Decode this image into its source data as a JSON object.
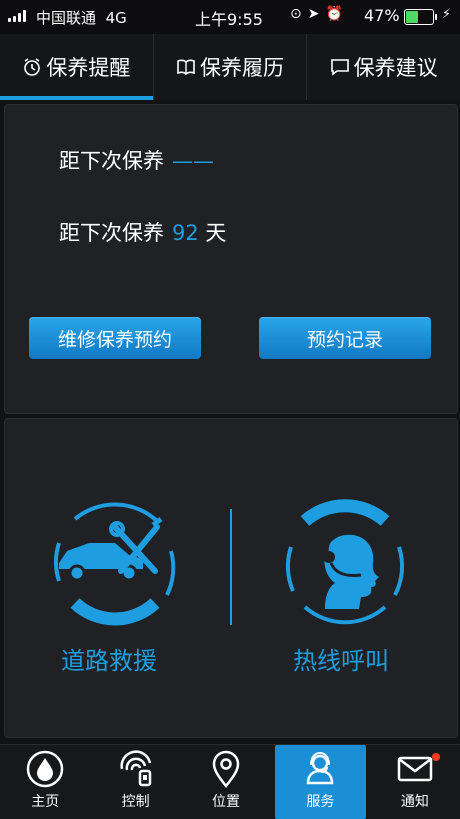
{
  "status_bar": {
    "carrier": "中国联通",
    "network": "4G",
    "time": "上午9:55",
    "battery_percent": "47%",
    "battery_level": 0.47,
    "battery_color": "#4cd964"
  },
  "tabs": [
    {
      "label": "保养提醒",
      "icon": "alarm-clock-icon",
      "active": true
    },
    {
      "label": "保养履历",
      "icon": "book-icon",
      "active": false
    },
    {
      "label": "保养建议",
      "icon": "comment-icon",
      "active": false
    }
  ],
  "maintenance": {
    "line1_label": "距下次保养",
    "line1_value": "——",
    "line2_label": "距下次保养",
    "line2_value": "92",
    "line2_unit": "天",
    "book_button": "维修保养预约",
    "records_button": "预约记录"
  },
  "services": {
    "rescue_label": "道路救援",
    "hotline_label": "热线呼叫"
  },
  "bottom_nav": [
    {
      "label": "主页",
      "icon": "home-drop-icon",
      "active": false
    },
    {
      "label": "控制",
      "icon": "control-icon",
      "active": false
    },
    {
      "label": "位置",
      "icon": "location-pin-icon",
      "active": false
    },
    {
      "label": "服务",
      "icon": "service-person-icon",
      "active": true
    },
    {
      "label": "通知",
      "icon": "mail-icon",
      "active": false,
      "badge": true
    }
  ],
  "colors": {
    "accent": "#1e9de0",
    "background": "#111214",
    "panel": "#202124"
  }
}
